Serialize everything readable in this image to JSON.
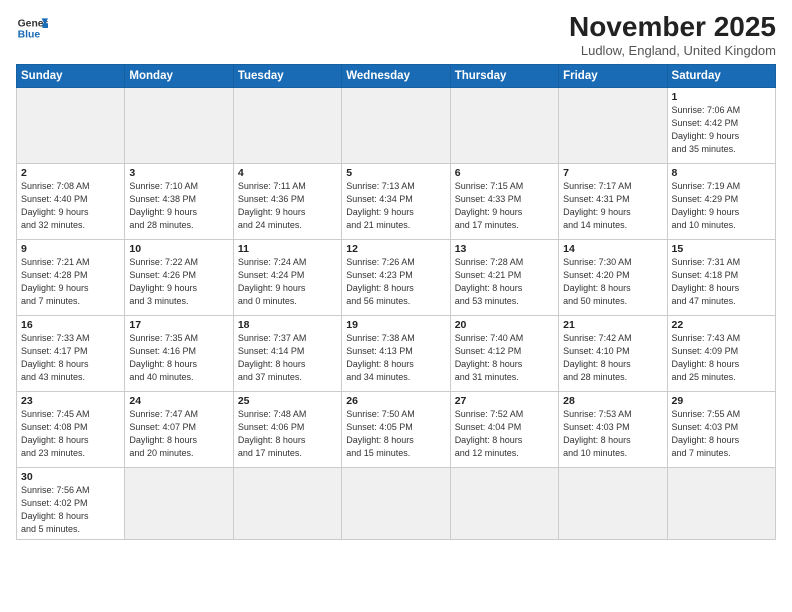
{
  "header": {
    "logo_general": "General",
    "logo_blue": "Blue",
    "month_title": "November 2025",
    "location": "Ludlow, England, United Kingdom"
  },
  "weekdays": [
    "Sunday",
    "Monday",
    "Tuesday",
    "Wednesday",
    "Thursday",
    "Friday",
    "Saturday"
  ],
  "weeks": [
    [
      {
        "day": "",
        "info": ""
      },
      {
        "day": "",
        "info": ""
      },
      {
        "day": "",
        "info": ""
      },
      {
        "day": "",
        "info": ""
      },
      {
        "day": "",
        "info": ""
      },
      {
        "day": "",
        "info": ""
      },
      {
        "day": "1",
        "info": "Sunrise: 7:06 AM\nSunset: 4:42 PM\nDaylight: 9 hours\nand 35 minutes."
      }
    ],
    [
      {
        "day": "2",
        "info": "Sunrise: 7:08 AM\nSunset: 4:40 PM\nDaylight: 9 hours\nand 32 minutes."
      },
      {
        "day": "3",
        "info": "Sunrise: 7:10 AM\nSunset: 4:38 PM\nDaylight: 9 hours\nand 28 minutes."
      },
      {
        "day": "4",
        "info": "Sunrise: 7:11 AM\nSunset: 4:36 PM\nDaylight: 9 hours\nand 24 minutes."
      },
      {
        "day": "5",
        "info": "Sunrise: 7:13 AM\nSunset: 4:34 PM\nDaylight: 9 hours\nand 21 minutes."
      },
      {
        "day": "6",
        "info": "Sunrise: 7:15 AM\nSunset: 4:33 PM\nDaylight: 9 hours\nand 17 minutes."
      },
      {
        "day": "7",
        "info": "Sunrise: 7:17 AM\nSunset: 4:31 PM\nDaylight: 9 hours\nand 14 minutes."
      },
      {
        "day": "8",
        "info": "Sunrise: 7:19 AM\nSunset: 4:29 PM\nDaylight: 9 hours\nand 10 minutes."
      }
    ],
    [
      {
        "day": "9",
        "info": "Sunrise: 7:21 AM\nSunset: 4:28 PM\nDaylight: 9 hours\nand 7 minutes."
      },
      {
        "day": "10",
        "info": "Sunrise: 7:22 AM\nSunset: 4:26 PM\nDaylight: 9 hours\nand 3 minutes."
      },
      {
        "day": "11",
        "info": "Sunrise: 7:24 AM\nSunset: 4:24 PM\nDaylight: 9 hours\nand 0 minutes."
      },
      {
        "day": "12",
        "info": "Sunrise: 7:26 AM\nSunset: 4:23 PM\nDaylight: 8 hours\nand 56 minutes."
      },
      {
        "day": "13",
        "info": "Sunrise: 7:28 AM\nSunset: 4:21 PM\nDaylight: 8 hours\nand 53 minutes."
      },
      {
        "day": "14",
        "info": "Sunrise: 7:30 AM\nSunset: 4:20 PM\nDaylight: 8 hours\nand 50 minutes."
      },
      {
        "day": "15",
        "info": "Sunrise: 7:31 AM\nSunset: 4:18 PM\nDaylight: 8 hours\nand 47 minutes."
      }
    ],
    [
      {
        "day": "16",
        "info": "Sunrise: 7:33 AM\nSunset: 4:17 PM\nDaylight: 8 hours\nand 43 minutes."
      },
      {
        "day": "17",
        "info": "Sunrise: 7:35 AM\nSunset: 4:16 PM\nDaylight: 8 hours\nand 40 minutes."
      },
      {
        "day": "18",
        "info": "Sunrise: 7:37 AM\nSunset: 4:14 PM\nDaylight: 8 hours\nand 37 minutes."
      },
      {
        "day": "19",
        "info": "Sunrise: 7:38 AM\nSunset: 4:13 PM\nDaylight: 8 hours\nand 34 minutes."
      },
      {
        "day": "20",
        "info": "Sunrise: 7:40 AM\nSunset: 4:12 PM\nDaylight: 8 hours\nand 31 minutes."
      },
      {
        "day": "21",
        "info": "Sunrise: 7:42 AM\nSunset: 4:10 PM\nDaylight: 8 hours\nand 28 minutes."
      },
      {
        "day": "22",
        "info": "Sunrise: 7:43 AM\nSunset: 4:09 PM\nDaylight: 8 hours\nand 25 minutes."
      }
    ],
    [
      {
        "day": "23",
        "info": "Sunrise: 7:45 AM\nSunset: 4:08 PM\nDaylight: 8 hours\nand 23 minutes."
      },
      {
        "day": "24",
        "info": "Sunrise: 7:47 AM\nSunset: 4:07 PM\nDaylight: 8 hours\nand 20 minutes."
      },
      {
        "day": "25",
        "info": "Sunrise: 7:48 AM\nSunset: 4:06 PM\nDaylight: 8 hours\nand 17 minutes."
      },
      {
        "day": "26",
        "info": "Sunrise: 7:50 AM\nSunset: 4:05 PM\nDaylight: 8 hours\nand 15 minutes."
      },
      {
        "day": "27",
        "info": "Sunrise: 7:52 AM\nSunset: 4:04 PM\nDaylight: 8 hours\nand 12 minutes."
      },
      {
        "day": "28",
        "info": "Sunrise: 7:53 AM\nSunset: 4:03 PM\nDaylight: 8 hours\nand 10 minutes."
      },
      {
        "day": "29",
        "info": "Sunrise: 7:55 AM\nSunset: 4:03 PM\nDaylight: 8 hours\nand 7 minutes."
      }
    ],
    [
      {
        "day": "30",
        "info": "Sunrise: 7:56 AM\nSunset: 4:02 PM\nDaylight: 8 hours\nand 5 minutes."
      },
      {
        "day": "",
        "info": ""
      },
      {
        "day": "",
        "info": ""
      },
      {
        "day": "",
        "info": ""
      },
      {
        "day": "",
        "info": ""
      },
      {
        "day": "",
        "info": ""
      },
      {
        "day": "",
        "info": ""
      }
    ]
  ]
}
